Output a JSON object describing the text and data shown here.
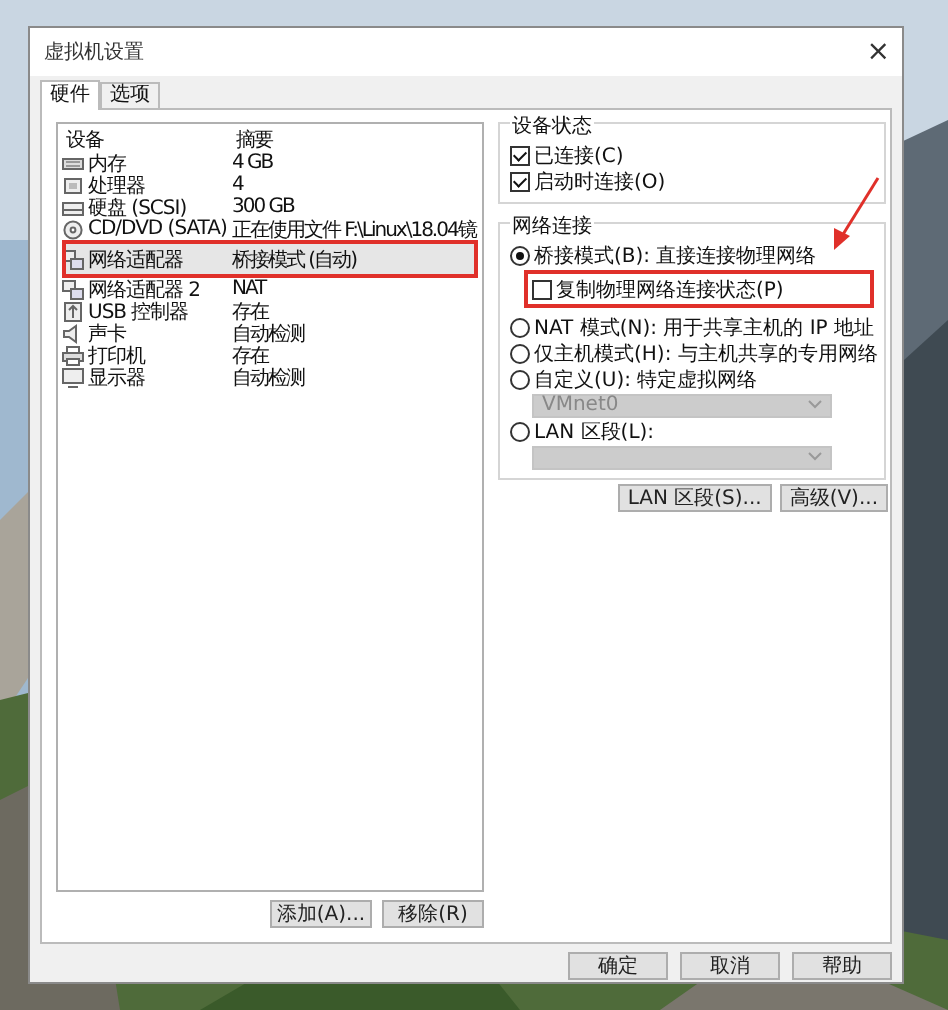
{
  "window": {
    "title": "虚拟机设置",
    "close": "×"
  },
  "tabs": [
    {
      "label": "硬件",
      "selected": true
    },
    {
      "label": "选项",
      "selected": false
    }
  ],
  "device_table": {
    "columns": [
      "设备",
      "摘要"
    ],
    "rows": [
      {
        "kind": "memory",
        "device": "内存",
        "summary": "4 GB",
        "selected": false,
        "highlighted": false
      },
      {
        "kind": "cpu",
        "device": "处理器",
        "summary": "4",
        "selected": false,
        "highlighted": false
      },
      {
        "kind": "disk",
        "device": "硬盘 (SCSI)",
        "summary": "300 GB",
        "selected": false,
        "highlighted": false
      },
      {
        "kind": "cdrom",
        "device": "CD/DVD (SATA)",
        "summary": "正在使用文件 F:\\Linux\\18.04镜",
        "selected": false,
        "highlighted": false
      },
      {
        "kind": "network",
        "device": "网络适配器",
        "summary": "桥接模式 (自动)",
        "selected": true,
        "highlighted": true
      },
      {
        "kind": "network",
        "device": "网络适配器 2",
        "summary": "NAT",
        "selected": false,
        "highlighted": false
      },
      {
        "kind": "usb",
        "device": "USB 控制器",
        "summary": "存在",
        "selected": false,
        "highlighted": false
      },
      {
        "kind": "sound",
        "device": "声卡",
        "summary": "自动检测",
        "selected": false,
        "highlighted": false
      },
      {
        "kind": "printer",
        "device": "打印机",
        "summary": "存在",
        "selected": false,
        "highlighted": false
      },
      {
        "kind": "display",
        "device": "显示器",
        "summary": "自动检测",
        "selected": false,
        "highlighted": false
      }
    ]
  },
  "device_buttons": [
    "添加(A)...",
    "移除(R)"
  ],
  "device_status": {
    "title": "设备状态",
    "options": [
      {
        "label": "已连接(C)",
        "checked": true
      },
      {
        "label": "启动时连接(O)",
        "checked": true
      }
    ]
  },
  "network": {
    "title": "网络连接",
    "options": [
      {
        "kind": "radio",
        "label": "桥接模式(B): 直接连接物理网络",
        "selected": true
      },
      {
        "kind": "checkbox",
        "label": "复制物理网络连接状态(P)",
        "checked": false,
        "highlighted": true
      },
      {
        "kind": "radio",
        "label": "NAT 模式(N): 用于共享主机的 IP 地址",
        "selected": false
      },
      {
        "kind": "radio",
        "label": "仅主机模式(H): 与主机共享的专用网络",
        "selected": false
      },
      {
        "kind": "radio",
        "label": "自定义(U): 特定虚拟网络",
        "selected": false
      },
      {
        "kind": "dropdown",
        "value": "VMnet0",
        "disabled": true
      },
      {
        "kind": "radio",
        "label": "LAN 区段(L):",
        "selected": false
      },
      {
        "kind": "dropdown",
        "disabled": true
      }
    ]
  },
  "network_buttons": [
    "LAN 区段(S)...",
    "高级(V)..."
  ],
  "dialog_buttons": [
    "确定",
    "取消",
    "帮助"
  ]
}
